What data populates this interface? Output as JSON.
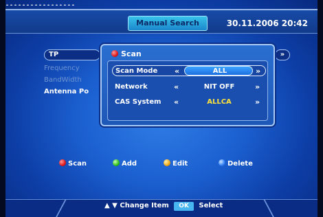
{
  "header": {
    "cropped_top_text": "ꞈꞈꞈꞈꞈꞈꞈꞈꞈꞈꞈꞈꞈꞈꞈꞈꞈ",
    "title": "Manual Search",
    "datetime": "30.11.2006 20:42"
  },
  "background_menu": {
    "tp_label": "TP",
    "items": [
      "Frequency",
      "BandWidth",
      "Antenna Po"
    ],
    "right_arrow": "»"
  },
  "dialog": {
    "title": "Scan",
    "rows": [
      {
        "label": "Scan Mode",
        "left": "«",
        "value": "ALL",
        "right": "»"
      },
      {
        "label": "Network",
        "left": "«",
        "value": "NIT OFF",
        "right": "»"
      },
      {
        "label": "CAS System",
        "left": "«",
        "value": "ALLCA",
        "right": "»"
      }
    ]
  },
  "keys": [
    {
      "label": "Scan",
      "color": "red"
    },
    {
      "label": "Add",
      "color": "green"
    },
    {
      "label": "Edit",
      "color": "yellow"
    },
    {
      "label": "Delete",
      "color": "blue"
    }
  ],
  "footer": {
    "nav_arrows": "▲ ▼",
    "change_label": "Change Item",
    "ok_label": "OK",
    "select_label": "Select"
  }
}
